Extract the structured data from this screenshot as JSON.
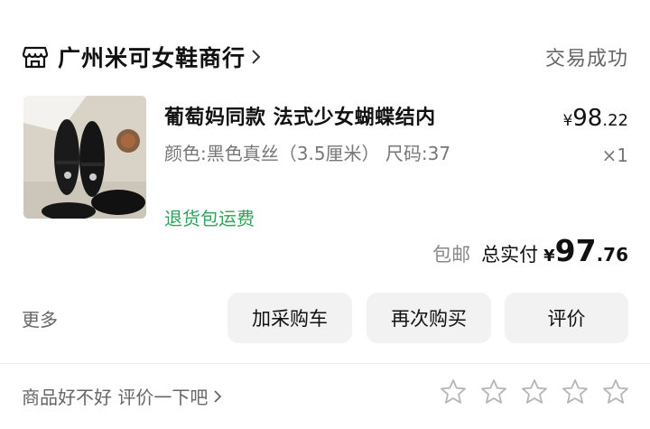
{
  "store": {
    "name": "广州米可女鞋商行",
    "icon": "store-icon",
    "status": "交易成功"
  },
  "product": {
    "title": "葡萄妈同款 法式少女蝴蝶结内",
    "spec": "颜色:黑色真丝（3.5厘米） 尺码:37",
    "return_tag": "退货包运费",
    "price": {
      "currency": "¥",
      "integer": "98",
      "decimal": ".22"
    },
    "quantity": "×1"
  },
  "total": {
    "free_shipping": "包邮",
    "label": "总实付",
    "currency": "¥",
    "integer": "97",
    "decimal": ".76"
  },
  "actions": {
    "more": "更多",
    "add_to_cart": "加采购车",
    "buy_again": "再次购买",
    "review": "评价"
  },
  "review_prompt": {
    "text": "商品好不好 评价一下吧",
    "stars": 5
  },
  "colors": {
    "return_green": "#2ea35a",
    "button_bg": "#f2f2f2",
    "secondary_text": "#777777"
  }
}
